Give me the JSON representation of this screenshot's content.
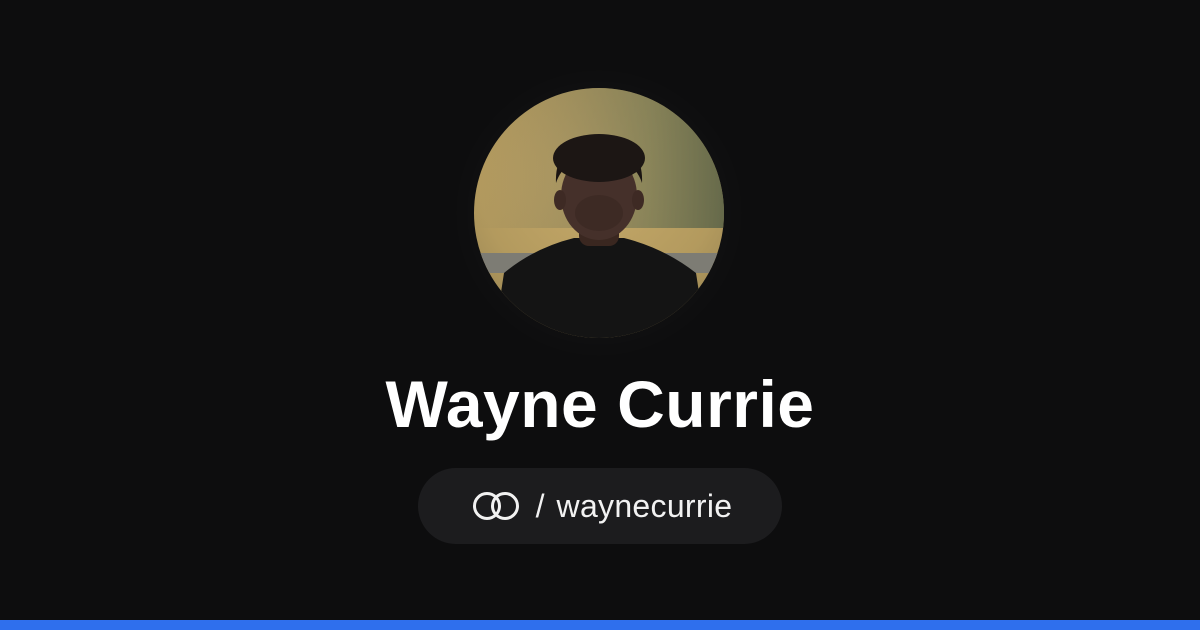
{
  "profile": {
    "display_name": "Wayne Currie",
    "separator": "/",
    "handle": "waynecurrie",
    "avatar_alt": "Wayne Currie profile photo"
  },
  "icons": {
    "brand": "linked-rings-icon"
  },
  "colors": {
    "background": "#0d0d0e",
    "pill": "#1c1c1e",
    "text": "#ffffff",
    "accent_bar": "#2f6fed"
  }
}
